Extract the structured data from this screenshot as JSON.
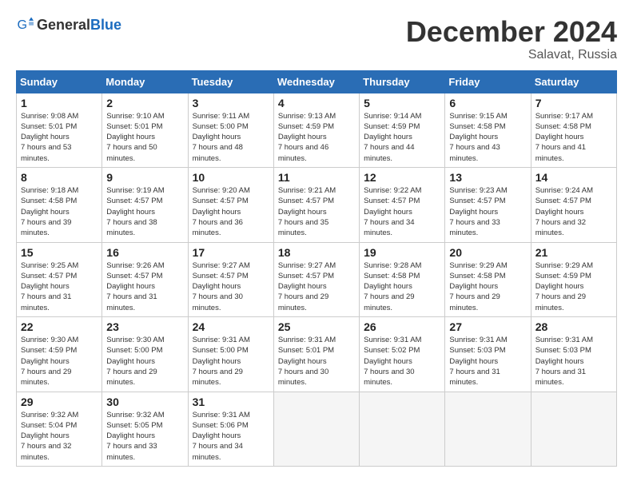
{
  "header": {
    "logo_general": "General",
    "logo_blue": "Blue",
    "month_title": "December 2024",
    "location": "Salavat, Russia"
  },
  "weekdays": [
    "Sunday",
    "Monday",
    "Tuesday",
    "Wednesday",
    "Thursday",
    "Friday",
    "Saturday"
  ],
  "weeks": [
    [
      {
        "day": "1",
        "sunrise": "9:08 AM",
        "sunset": "5:01 PM",
        "daylight": "7 hours and 53 minutes."
      },
      {
        "day": "2",
        "sunrise": "9:10 AM",
        "sunset": "5:01 PM",
        "daylight": "7 hours and 50 minutes."
      },
      {
        "day": "3",
        "sunrise": "9:11 AM",
        "sunset": "5:00 PM",
        "daylight": "7 hours and 48 minutes."
      },
      {
        "day": "4",
        "sunrise": "9:13 AM",
        "sunset": "4:59 PM",
        "daylight": "7 hours and 46 minutes."
      },
      {
        "day": "5",
        "sunrise": "9:14 AM",
        "sunset": "4:59 PM",
        "daylight": "7 hours and 44 minutes."
      },
      {
        "day": "6",
        "sunrise": "9:15 AM",
        "sunset": "4:58 PM",
        "daylight": "7 hours and 43 minutes."
      },
      {
        "day": "7",
        "sunrise": "9:17 AM",
        "sunset": "4:58 PM",
        "daylight": "7 hours and 41 minutes."
      }
    ],
    [
      {
        "day": "8",
        "sunrise": "9:18 AM",
        "sunset": "4:58 PM",
        "daylight": "7 hours and 39 minutes."
      },
      {
        "day": "9",
        "sunrise": "9:19 AM",
        "sunset": "4:57 PM",
        "daylight": "7 hours and 38 minutes."
      },
      {
        "day": "10",
        "sunrise": "9:20 AM",
        "sunset": "4:57 PM",
        "daylight": "7 hours and 36 minutes."
      },
      {
        "day": "11",
        "sunrise": "9:21 AM",
        "sunset": "4:57 PM",
        "daylight": "7 hours and 35 minutes."
      },
      {
        "day": "12",
        "sunrise": "9:22 AM",
        "sunset": "4:57 PM",
        "daylight": "7 hours and 34 minutes."
      },
      {
        "day": "13",
        "sunrise": "9:23 AM",
        "sunset": "4:57 PM",
        "daylight": "7 hours and 33 minutes."
      },
      {
        "day": "14",
        "sunrise": "9:24 AM",
        "sunset": "4:57 PM",
        "daylight": "7 hours and 32 minutes."
      }
    ],
    [
      {
        "day": "15",
        "sunrise": "9:25 AM",
        "sunset": "4:57 PM",
        "daylight": "7 hours and 31 minutes."
      },
      {
        "day": "16",
        "sunrise": "9:26 AM",
        "sunset": "4:57 PM",
        "daylight": "7 hours and 31 minutes."
      },
      {
        "day": "17",
        "sunrise": "9:27 AM",
        "sunset": "4:57 PM",
        "daylight": "7 hours and 30 minutes."
      },
      {
        "day": "18",
        "sunrise": "9:27 AM",
        "sunset": "4:57 PM",
        "daylight": "7 hours and 29 minutes."
      },
      {
        "day": "19",
        "sunrise": "9:28 AM",
        "sunset": "4:58 PM",
        "daylight": "7 hours and 29 minutes."
      },
      {
        "day": "20",
        "sunrise": "9:29 AM",
        "sunset": "4:58 PM",
        "daylight": "7 hours and 29 minutes."
      },
      {
        "day": "21",
        "sunrise": "9:29 AM",
        "sunset": "4:59 PM",
        "daylight": "7 hours and 29 minutes."
      }
    ],
    [
      {
        "day": "22",
        "sunrise": "9:30 AM",
        "sunset": "4:59 PM",
        "daylight": "7 hours and 29 minutes."
      },
      {
        "day": "23",
        "sunrise": "9:30 AM",
        "sunset": "5:00 PM",
        "daylight": "7 hours and 29 minutes."
      },
      {
        "day": "24",
        "sunrise": "9:31 AM",
        "sunset": "5:00 PM",
        "daylight": "7 hours and 29 minutes."
      },
      {
        "day": "25",
        "sunrise": "9:31 AM",
        "sunset": "5:01 PM",
        "daylight": "7 hours and 30 minutes."
      },
      {
        "day": "26",
        "sunrise": "9:31 AM",
        "sunset": "5:02 PM",
        "daylight": "7 hours and 30 minutes."
      },
      {
        "day": "27",
        "sunrise": "9:31 AM",
        "sunset": "5:03 PM",
        "daylight": "7 hours and 31 minutes."
      },
      {
        "day": "28",
        "sunrise": "9:31 AM",
        "sunset": "5:03 PM",
        "daylight": "7 hours and 31 minutes."
      }
    ],
    [
      {
        "day": "29",
        "sunrise": "9:32 AM",
        "sunset": "5:04 PM",
        "daylight": "7 hours and 32 minutes."
      },
      {
        "day": "30",
        "sunrise": "9:32 AM",
        "sunset": "5:05 PM",
        "daylight": "7 hours and 33 minutes."
      },
      {
        "day": "31",
        "sunrise": "9:31 AM",
        "sunset": "5:06 PM",
        "daylight": "7 hours and 34 minutes."
      },
      null,
      null,
      null,
      null
    ]
  ]
}
